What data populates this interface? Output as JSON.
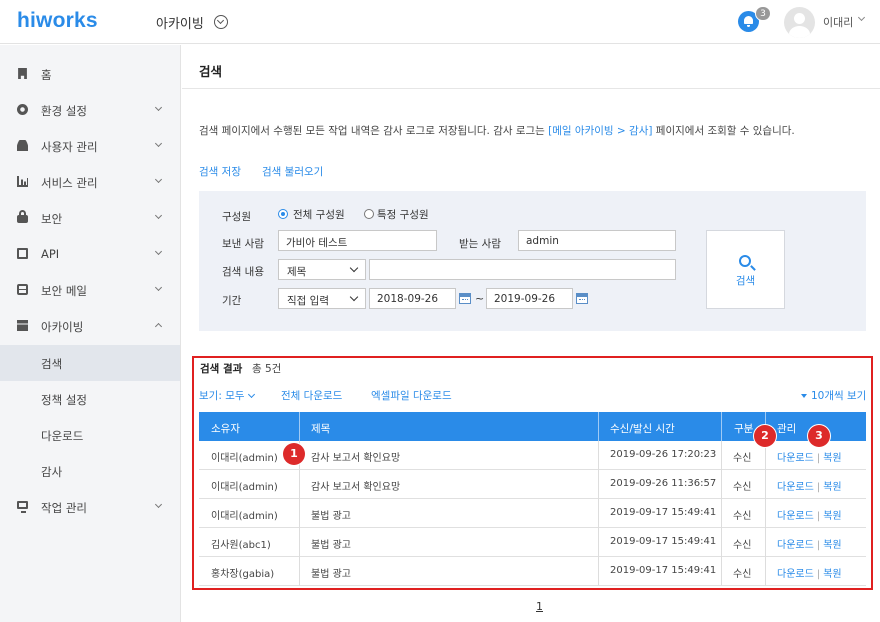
{
  "header": {
    "logo": "hiworks",
    "app_title": "아카이빙",
    "notification_count": "3",
    "user_name": "이대리"
  },
  "sidebar": {
    "items": [
      {
        "label": "홈",
        "icon": "home-icon"
      },
      {
        "label": "환경 설정",
        "icon": "gear-icon"
      },
      {
        "label": "사용자 관리",
        "icon": "user-icon"
      },
      {
        "label": "서비스 관리",
        "icon": "chart-icon"
      },
      {
        "label": "보안",
        "icon": "lock-icon"
      },
      {
        "label": "API",
        "icon": "api-icon"
      },
      {
        "label": "보안 메일",
        "icon": "mail-icon"
      },
      {
        "label": "아카이빙",
        "icon": "archive-icon"
      }
    ],
    "sub_items": [
      {
        "label": "검색",
        "active": true
      },
      {
        "label": "정책 설정"
      },
      {
        "label": "다운로드"
      },
      {
        "label": "감사"
      }
    ],
    "last_item": {
      "label": "작업 관리",
      "icon": "monitor-icon"
    }
  },
  "main": {
    "title": "검색",
    "description_prefix": "검색 페이지에서 수행된 모든 작업 내역은 감사 로그로 저장됩니다. 감사 로그는 ",
    "description_link": "[메일 아카이빙 > 감사]",
    "description_suffix": " 페이지에서 조회할 수 있습니다.",
    "save_search": "검색 저장",
    "load_search": "검색 불러오기"
  },
  "search_form": {
    "member_label": "구성원",
    "member_all": "전체 구성원",
    "member_specific": "특정 구성원",
    "sender_label": "보낸 사람",
    "sender_value": "가비아 테스트",
    "recipient_label": "받는 사람",
    "recipient_value": "admin",
    "content_label": "검색 내용",
    "content_type": "제목",
    "content_value": "",
    "period_label": "기간",
    "period_type": "직접 입력",
    "date_from": "2018-09-26",
    "date_separator": "~",
    "date_to": "2019-09-26",
    "search_button": "검색"
  },
  "results": {
    "title": "검색 결과",
    "count": "총 5건",
    "view_filter": "보기: 모두",
    "download_all": "전체 다운로드",
    "excel_download": "엑셀파일 다운로드",
    "page_size": "10개씩 보기",
    "columns": [
      "소유자",
      "제목",
      "수신/발신 시간",
      "구분",
      "관리"
    ],
    "rows": [
      {
        "owner": "이대리(admin)",
        "subject": "감사 보고서 확인요망",
        "time": "2019-09-26 17:20:23",
        "type": "수신"
      },
      {
        "owner": "이대리(admin)",
        "subject": "감사 보고서 확인요망",
        "time": "2019-09-26 11:36:57",
        "type": "수신"
      },
      {
        "owner": "이대리(admin)",
        "subject": "불법 광고",
        "time": "2019-09-17 15:49:41",
        "type": "수신"
      },
      {
        "owner": "김사원(abc1)",
        "subject": "불법 광고",
        "time": "2019-09-17 15:49:41",
        "type": "수신"
      },
      {
        "owner": "홍차장(gabia)",
        "subject": "불법 광고",
        "time": "2019-09-17 15:49:41",
        "type": "수신"
      }
    ],
    "action_download": "다운로드",
    "action_restore": "복원",
    "action_separator": "|"
  },
  "markers": [
    "1",
    "2",
    "3"
  ],
  "pagination": {
    "current": "1"
  },
  "colors": {
    "accent": "#2a8be8",
    "highlight_box": "#e02020",
    "marker": "#dd2a2a",
    "sidebar_bg": "#f4f5f7",
    "panel_bg": "#eef1f7"
  }
}
